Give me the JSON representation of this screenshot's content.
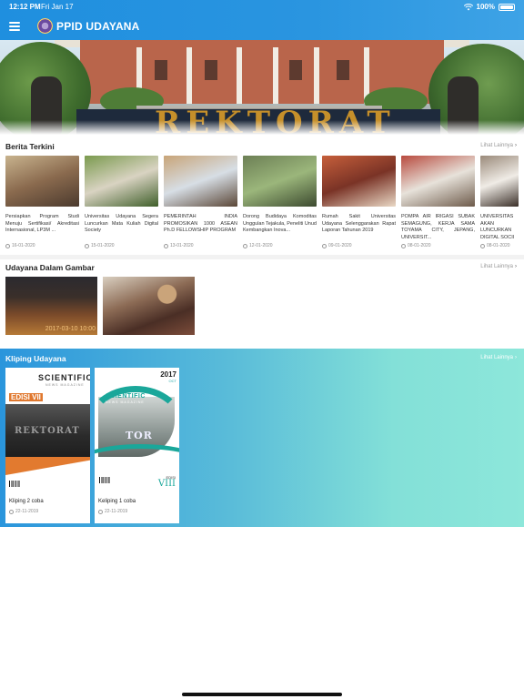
{
  "status_bar": {
    "time": "12:12 PM",
    "date": "Fri Jan 17",
    "battery": "100%"
  },
  "header": {
    "title": "PPID UDAYANA",
    "menu_icon": "hamburger-menu-icon"
  },
  "banner": {
    "sign_text": "REKTORAT"
  },
  "news": {
    "title": "Berita Terkini",
    "see_more": "Lihat Lainnya",
    "items": [
      {
        "title": "Persiapkan Program Studi Menuju Sertifikasi/ Akreditasi Internasional, LP3M ...",
        "date": "16-01-2020",
        "thumb": [
          "#8a6a4e",
          "#c8b38e",
          "#4b3a2e"
        ]
      },
      {
        "title": "Universitas Udayana Segera Luncurkan Mata Kuliah Digital Society",
        "date": "15-01-2020",
        "thumb": [
          "#d9d3c2",
          "#7a9a4e",
          "#3f5f2a"
        ]
      },
      {
        "title": "PEMERINTAH INDIA PROMOSIKAN 1000 ASEAN Ph.D FELLOWSHIP PROGRAM",
        "date": "13-01-2020",
        "thumb": [
          "#d7dee5",
          "#c8a478",
          "#5a4636"
        ]
      },
      {
        "title": "Dorong Budidaya Komoditas Unggulan Tejakula, Peneliti Unud Kembangkan Inova...",
        "date": "12-01-2020",
        "thumb": [
          "#9bb67b",
          "#6c7f55",
          "#3c4a2f"
        ]
      },
      {
        "title": "Rumah Sakit Universitas Udayana Selenggarakan Rapat Laporan Tahunan 2019",
        "date": "09-01-2020",
        "thumb": [
          "#7a3326",
          "#c65f3b",
          "#e9d8c5"
        ]
      },
      {
        "title": "POMPA AIR IRIGASI SUBAK SEMAGUNG, KERJA SAMA TOYAMA CITY, JEPANG, UNIVERSIT...",
        "date": "08-01-2020",
        "thumb": [
          "#e7e2da",
          "#b84a3e",
          "#6d5a4a"
        ]
      },
      {
        "title": "UNIVERSITAS AKAN LUNCURKAN DIGITAL SOCII",
        "date": "08-01-2020",
        "thumb": [
          "#f0ece6",
          "#9a8a7a",
          "#3a2f28"
        ]
      }
    ]
  },
  "gallery": {
    "title": "Udayana Dalam Gambar",
    "see_more": "Lihat Lainnya",
    "items": [
      {
        "caption": "2017-03-10 10:00"
      },
      {
        "caption": ""
      }
    ]
  },
  "kliping": {
    "title": "Kliping Udayana",
    "see_more": "Lihat Lainnya",
    "items": [
      {
        "title": "Kliping 2 coba",
        "date": "22-11-2019",
        "cover": {
          "masthead": "SCIENTIFIC",
          "subtitle": "NEWS MAGAZINE",
          "edition": "EDISI VII",
          "photo_text": "REKTORAT"
        }
      },
      {
        "title": "Keliping 1 coba",
        "date": "22-11-2019",
        "cover": {
          "year": "2017",
          "month": "OCT",
          "masthead": "SCIENTIFIC",
          "subtitle": "NEWS MAGAZINE",
          "edition_label": "EDISI",
          "edition_num": "VIII",
          "photo_text": "TOR"
        }
      }
    ]
  },
  "colors": {
    "header_blue": "#2a95e0",
    "kliping_start": "#2a95dc",
    "kliping_end": "#8de7da",
    "accent_orange": "#e0782e",
    "accent_teal": "#1aa79a"
  }
}
